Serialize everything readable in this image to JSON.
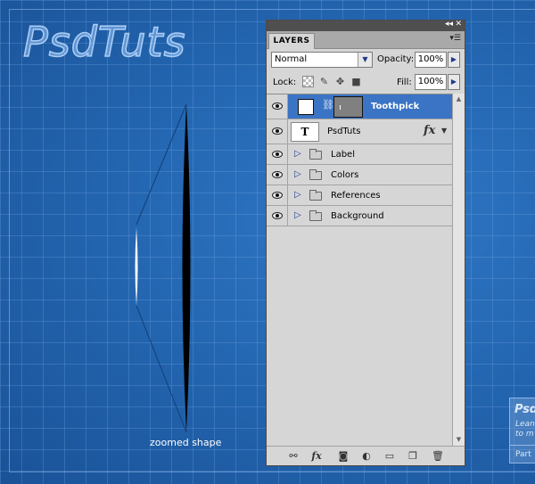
{
  "canvas": {
    "logo_text": "PsdTuts",
    "zoomed_label": "zoomed shape",
    "side_card": {
      "title": "Psd",
      "line1": "Lean",
      "line2": "to m",
      "footer": "Part"
    }
  },
  "panel": {
    "tab_label": "LAYERS",
    "blend_mode": "Normal",
    "opacity_label": "Opacity:",
    "opacity_value": "100%",
    "lock_label": "Lock:",
    "fill_label": "Fill:",
    "fill_value": "100%",
    "layers": [
      {
        "name": "Toothpick",
        "type": "shape",
        "selected": true
      },
      {
        "name": "PsdTuts",
        "type": "text",
        "thumb": "T",
        "fx": "fx"
      },
      {
        "name": "Label",
        "type": "group"
      },
      {
        "name": "Colors",
        "type": "group"
      },
      {
        "name": "References",
        "type": "group"
      },
      {
        "name": "Background",
        "type": "group"
      }
    ]
  },
  "colors": {
    "selection": "#3b74c4",
    "panel": "#d6d6d6",
    "blueprint": "#2263ad"
  }
}
